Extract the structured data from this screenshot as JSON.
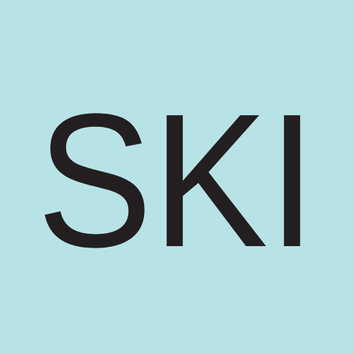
{
  "icon": {
    "wordmark": "SKI",
    "background_color": "#b8e3e6",
    "text_color": "#231f20"
  }
}
